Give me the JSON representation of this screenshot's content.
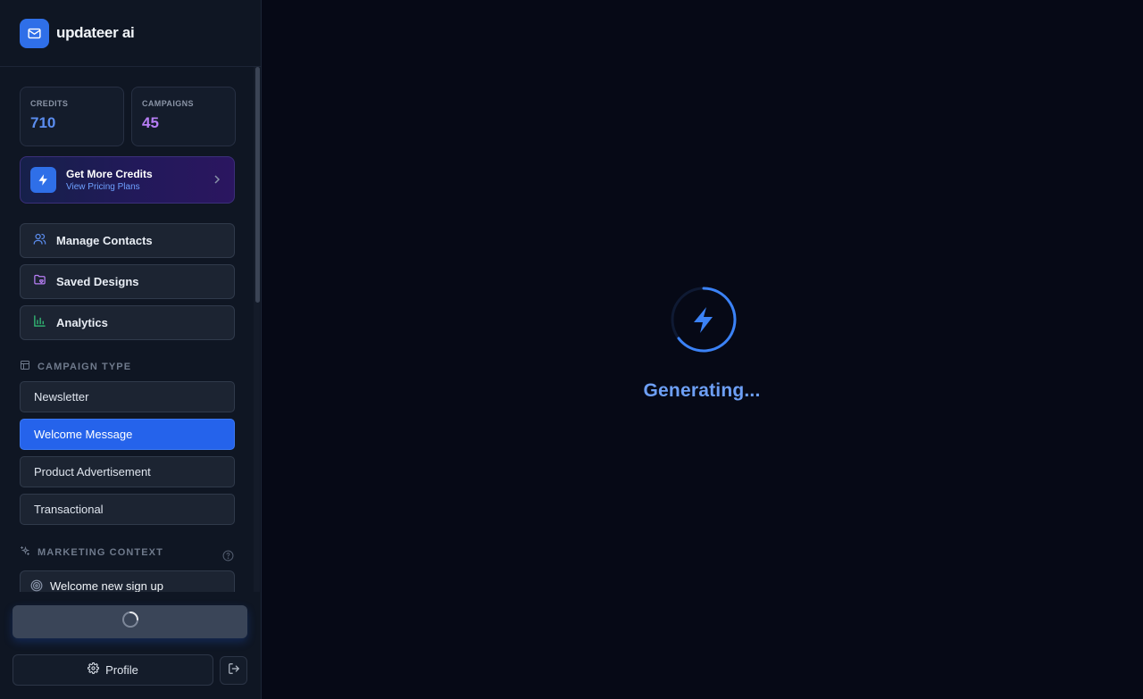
{
  "brand": {
    "name": "updateer ai"
  },
  "stats": [
    {
      "label": "CREDITS",
      "value": "710",
      "color": "#5b8def"
    },
    {
      "label": "CAMPAIGNS",
      "value": "45",
      "color": "#b77ef5"
    }
  ],
  "promo": {
    "title": "Get More Credits",
    "subtitle": "View Pricing Plans"
  },
  "nav": [
    {
      "label": "Manage Contacts",
      "icon": "users-icon",
      "color": "#5b8def"
    },
    {
      "label": "Saved Designs",
      "icon": "folder-heart-icon",
      "color": "#b77ef5"
    },
    {
      "label": "Analytics",
      "icon": "bar-chart-icon",
      "color": "#34c77b"
    }
  ],
  "campaign_type": {
    "heading": "CAMPAIGN TYPE",
    "options": [
      "Newsletter",
      "Welcome Message",
      "Product Advertisement",
      "Transactional"
    ],
    "selected": "Welcome Message"
  },
  "marketing_context": {
    "heading": "MARKETING CONTEXT",
    "items": [
      {
        "label": "Welcome new sign up"
      }
    ]
  },
  "footer": {
    "profile_label": "Profile"
  },
  "main": {
    "status_text": "Generating..."
  },
  "colors": {
    "accent": "#2563eb",
    "loader": "#3b82f6"
  }
}
